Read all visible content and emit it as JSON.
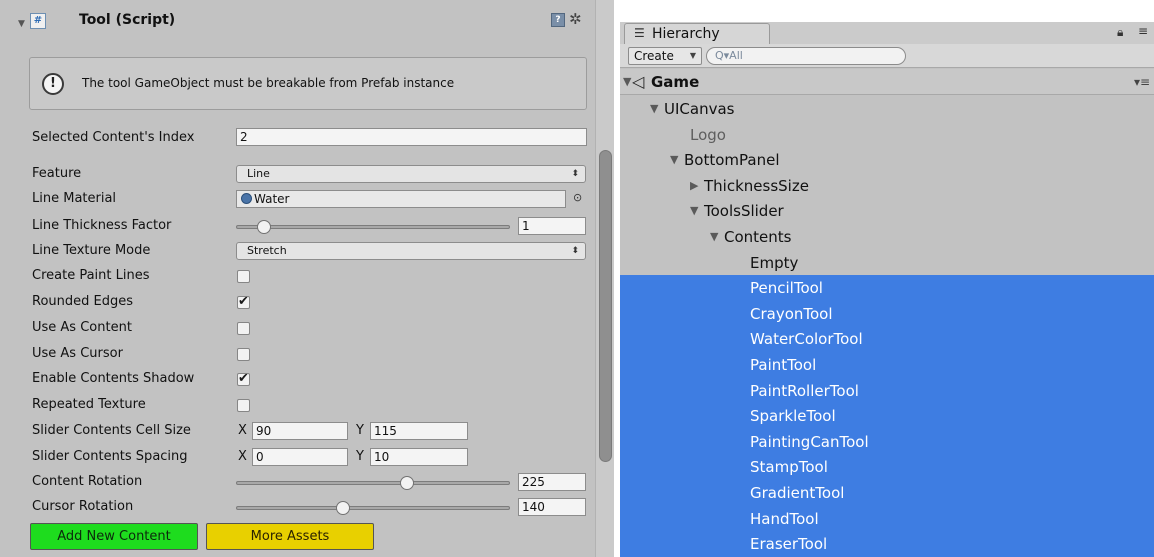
{
  "inspector": {
    "header": {
      "title": "Tool (Script)",
      "foldout_icon": "foldout-arrow-icon",
      "script_icon": "csharp-script-icon",
      "help_icon": "help-book-icon",
      "gear_icon": "gear-icon"
    },
    "help_box": {
      "icon": "info-icon",
      "text": "The tool GameObject must be breakable from Prefab instance"
    },
    "props": {
      "selected_index": {
        "label": "Selected Content's Index",
        "value": "2"
      },
      "feature": {
        "label": "Feature",
        "value": "Line"
      },
      "line_material": {
        "label": "Line Material",
        "value": "Water"
      },
      "line_thickness": {
        "label": "Line Thickness Factor",
        "value": "1",
        "slider_fraction": 0.1
      },
      "line_texture_mode": {
        "label": "Line Texture Mode",
        "value": "Stretch"
      },
      "create_paint_lines": {
        "label": "Create Paint Lines",
        "checked": false
      },
      "rounded_edges": {
        "label": "Rounded Edges",
        "checked": true
      },
      "use_as_content": {
        "label": "Use As Content",
        "checked": false
      },
      "use_as_cursor": {
        "label": "Use As Cursor",
        "checked": false
      },
      "enable_contents_shadow": {
        "label": "Enable Contents Shadow",
        "checked": true
      },
      "repeated_texture": {
        "label": "Repeated Texture",
        "checked": false
      },
      "cell_size": {
        "label": "Slider Contents Cell Size",
        "x_label": "X",
        "x": "90",
        "y_label": "Y",
        "y": "115"
      },
      "spacing": {
        "label": "Slider Contents Spacing",
        "x_label": "X",
        "x": "0",
        "y_label": "Y",
        "y": "10"
      },
      "content_rotation": {
        "label": "Content Rotation",
        "value": "225",
        "slider_fraction": 0.625
      },
      "cursor_rotation": {
        "label": "Cursor Rotation",
        "value": "140",
        "slider_fraction": 0.39
      }
    },
    "buttons": {
      "add_new_content": "Add New Content",
      "more_assets": "More Assets"
    }
  },
  "hierarchy": {
    "tab_label": "Hierarchy",
    "create_label": "Create",
    "search_placeholder": "Q▾All",
    "scene_name": "Game",
    "rows": [
      {
        "label": "UICanvas",
        "depth": 1,
        "expanded": true,
        "selected": false
      },
      {
        "label": "Logo",
        "depth": 2,
        "expanded": null,
        "selected": false,
        "dim": true
      },
      {
        "label": "BottomPanel",
        "depth": 2,
        "expanded": true,
        "selected": false
      },
      {
        "label": "ThicknessSize",
        "depth": 3,
        "expanded": false,
        "selected": false
      },
      {
        "label": "ToolsSlider",
        "depth": 3,
        "expanded": true,
        "selected": false
      },
      {
        "label": "Contents",
        "depth": 4,
        "expanded": true,
        "selected": false
      },
      {
        "label": "Empty",
        "depth": 5,
        "expanded": null,
        "selected": false
      },
      {
        "label": "PencilTool",
        "depth": 5,
        "expanded": null,
        "selected": true
      },
      {
        "label": "CrayonTool",
        "depth": 5,
        "expanded": null,
        "selected": true
      },
      {
        "label": "WaterColorTool",
        "depth": 5,
        "expanded": null,
        "selected": true
      },
      {
        "label": "PaintTool",
        "depth": 5,
        "expanded": null,
        "selected": true
      },
      {
        "label": "PaintRollerTool",
        "depth": 5,
        "expanded": null,
        "selected": true
      },
      {
        "label": "SparkleTool",
        "depth": 5,
        "expanded": null,
        "selected": true
      },
      {
        "label": "PaintingCanTool",
        "depth": 5,
        "expanded": null,
        "selected": true
      },
      {
        "label": "StampTool",
        "depth": 5,
        "expanded": null,
        "selected": true
      },
      {
        "label": "GradientTool",
        "depth": 5,
        "expanded": null,
        "selected": true
      },
      {
        "label": "HandTool",
        "depth": 5,
        "expanded": null,
        "selected": true
      },
      {
        "label": "EraserTool",
        "depth": 5,
        "expanded": null,
        "selected": true
      }
    ]
  },
  "colors": {
    "selection": "#3e7de2",
    "add_button": "#1edc1e",
    "more_button": "#e8d000",
    "panel_bg": "#c2c2c2"
  }
}
